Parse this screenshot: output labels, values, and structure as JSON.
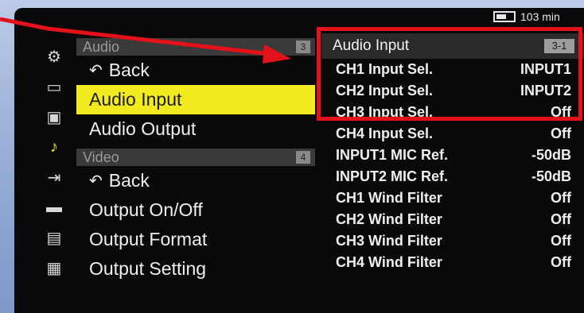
{
  "status": {
    "battery": "103 min"
  },
  "menu": {
    "cat1": {
      "label": "Audio",
      "num": "3"
    },
    "items1": [
      {
        "label": "Back",
        "icon": "back-arrow-icon"
      },
      {
        "label": "Audio Input",
        "selected": true
      },
      {
        "label": "Audio Output"
      }
    ],
    "cat2": {
      "label": "Video",
      "num": "4"
    },
    "items2": [
      {
        "label": "Back",
        "icon": "back-arrow-icon"
      },
      {
        "label": "Output On/Off"
      },
      {
        "label": "Output Format"
      },
      {
        "label": "Output Setting"
      }
    ]
  },
  "panel": {
    "title": "Audio Input",
    "tag": "3-1",
    "rows": [
      {
        "label": "CH1 Input Sel.",
        "value": "INPUT1"
      },
      {
        "label": "CH2 Input Sel.",
        "value": "INPUT2"
      },
      {
        "label": "CH3 Input Sel.",
        "value": "Off"
      },
      {
        "label": "CH4 Input Sel.",
        "value": "Off"
      },
      {
        "label": "INPUT1 MIC Ref.",
        "value": "-50dB"
      },
      {
        "label": "INPUT2 MIC Ref.",
        "value": "-50dB"
      },
      {
        "label": "CH1 Wind Filter",
        "value": "Off"
      },
      {
        "label": "CH2 Wind Filter",
        "value": "Off"
      },
      {
        "label": "CH3 Wind Filter",
        "value": "Off"
      },
      {
        "label": "CH4 Wind Filter",
        "value": "Off"
      }
    ]
  },
  "icons": [
    "camera-settings-icon",
    "media-icon",
    "file-icon",
    "music-note-icon",
    "output-icon",
    "display-icon",
    "timecode-icon",
    "network-icon"
  ],
  "colors": {
    "highlight": "#f3ea1f",
    "annotation": "#e4101a",
    "background": "#7a94c6"
  }
}
